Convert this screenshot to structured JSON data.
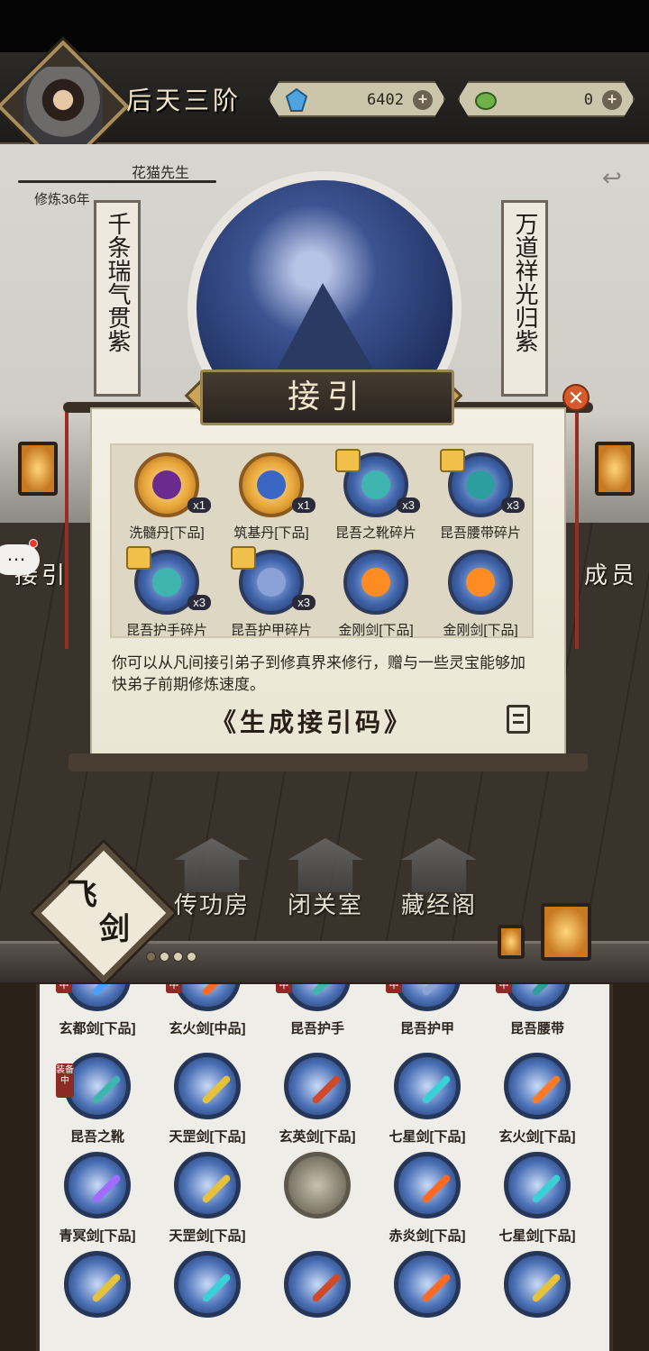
{
  "header": {
    "realm": "后天三阶",
    "player_name": "花猫先生",
    "cultivation": "修炼36年",
    "spirit_stones": "6402",
    "jade": "0"
  },
  "scene": {
    "left_couplet": "千条瑞气贯紫",
    "right_couplet": "万道祥光归紫",
    "left_side_label": "接引",
    "right_side_label": "成员"
  },
  "dialog": {
    "title": "接引",
    "close": "✕",
    "rewards": [
      {
        "label": "洗髓丹[下品]",
        "qty": "x1",
        "type": "gold",
        "color": "#6b2a8e"
      },
      {
        "label": "筑基丹[下品]",
        "qty": "x1",
        "type": "gold",
        "color": "#3a66c4"
      },
      {
        "label": "昆吾之靴碎片",
        "qty": "x3",
        "type": "blue",
        "color": "#3fb5b0"
      },
      {
        "label": "昆吾腰带碎片",
        "qty": "x3",
        "type": "blue",
        "color": "#2c9ea0"
      },
      {
        "label": "昆吾护手碎片",
        "qty": "x3",
        "type": "blue",
        "color": "#3fb5b0"
      },
      {
        "label": "昆吾护甲碎片",
        "qty": "x3",
        "type": "blue",
        "color": "#8aa2d8"
      },
      {
        "label": "金刚剑[下品]",
        "qty": "",
        "type": "blue",
        "color": "#ff8c22"
      },
      {
        "label": "金刚剑[下品]",
        "qty": "",
        "type": "blue",
        "color": "#ff8c22"
      }
    ],
    "description": "你可以从凡间接引弟子到修真界来修行，赠与一些灵宝能够加快弟子前期修炼速度。",
    "generate_button": "《生成接引码》"
  },
  "buildings": [
    {
      "name": "传功房"
    },
    {
      "name": "闭关室"
    },
    {
      "name": "藏经阁"
    }
  ],
  "fly_sword": {
    "line1": "飞",
    "line2": "剑"
  },
  "inventory": {
    "row1": [
      {
        "name": "玄都剑[下品]",
        "tag": "中",
        "color": "#4aa0ff"
      },
      {
        "name": "玄火剑[中品]",
        "tag": "中",
        "color": "#ff6a22"
      },
      {
        "name": "昆吾护手",
        "tag": "中",
        "color": "#3fb5b0"
      },
      {
        "name": "昆吾护甲",
        "tag": "中",
        "color": "#8aa2d8"
      },
      {
        "name": "昆吾腰带",
        "tag": "中",
        "color": "#2c9ea0"
      }
    ],
    "row2": [
      {
        "name": "昆吾之靴",
        "equipped": "装备中",
        "color": "#3fb5b0"
      },
      {
        "name": "天罡剑[下品]",
        "color": "#e6c23a"
      },
      {
        "name": "玄英剑[下品]",
        "color": "#d04a2a"
      },
      {
        "name": "七星剑[下品]",
        "color": "#3ad0d8"
      },
      {
        "name": "玄火剑[下品]",
        "color": "#ff7a22"
      }
    ],
    "row3": [
      {
        "name": "青冥剑[下品]",
        "color": "#a36bff"
      },
      {
        "name": "天罡剑[下品]",
        "color": "#e6c23a"
      },
      {
        "name": "",
        "color": ""
      },
      {
        "name": "赤炎剑[下品]",
        "color": "#ff6a22"
      },
      {
        "name": "七星剑[下品]",
        "color": "#3ad0d8"
      }
    ]
  }
}
